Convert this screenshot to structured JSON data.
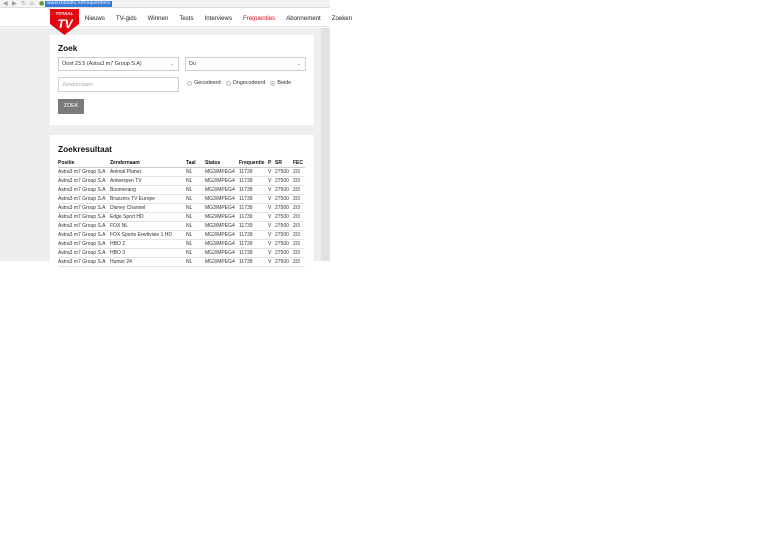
{
  "browser": {
    "url": "www.totaaltv.nl/frequenties/",
    "back_glyph": "◀",
    "forward_glyph": "▶",
    "reload_glyph": "↻",
    "home_glyph": "⌂"
  },
  "site": {
    "logo_text": "TOTAAL",
    "logo_letters": "TV",
    "brand_color": "#e30613"
  },
  "nav": [
    "Nieuws",
    "TV-gids",
    "Winnen",
    "Tests",
    "Interviews",
    "Frequenties",
    "Abonnement",
    "Zoeken"
  ],
  "nav_active": "Frequenties",
  "search": {
    "title": "Zoek",
    "satellite_select": "Oost 23.5 (Astra3 m7 Group S.A)",
    "language_select": "Du",
    "channel_placeholder": "Zendernaam",
    "radio_options": [
      "Gecodeerd",
      "Ongecodeerd",
      "Beide"
    ],
    "radio_selected": "Beide",
    "button_label": "ZOEK"
  },
  "results": {
    "title": "Zoekresultaat",
    "columns": [
      "Positie",
      "Zendernaam",
      "Taal",
      "Status",
      "Frequentie",
      "P",
      "SR",
      "FEC"
    ],
    "rows": [
      [
        "Astra3 m7 Group S.A",
        "Animal Planet",
        "NL",
        "MG3/MPEG4",
        "11739",
        "V",
        "27500",
        "2/3"
      ],
      [
        "Astra3 m7 Group S.A",
        "Antwerpen TV",
        "NL",
        "MG3/MPEG4",
        "11739",
        "V",
        "27500",
        "2/3"
      ],
      [
        "Astra3 m7 Group S.A",
        "Boomerang",
        "NL",
        "MG3/MPEG4",
        "11739",
        "V",
        "27500",
        "2/3"
      ],
      [
        "Astra3 m7 Group S.A",
        "Brazzers TV Europe",
        "NL",
        "MG3/MPEG4",
        "11739",
        "V",
        "27500",
        "2/3"
      ],
      [
        "Astra3 m7 Group S.A",
        "Disney Channel",
        "NL",
        "MG3/MPEG4",
        "11739",
        "V",
        "27500",
        "2/3"
      ],
      [
        "Astra3 m7 Group S.A",
        "Edge Sport HD",
        "NL",
        "MG3/MPEG4",
        "11739",
        "V",
        "27500",
        "2/3"
      ],
      [
        "Astra3 m7 Group S.A",
        "FOX NL",
        "NL",
        "MG3/MPEG4",
        "11739",
        "V",
        "27500",
        "2/3"
      ],
      [
        "Astra3 m7 Group S.A",
        "FOX Sports Eredivisie 1 HD",
        "NL",
        "MG3/MPEG4",
        "11739",
        "V",
        "27500",
        "2/3"
      ],
      [
        "Astra3 m7 Group S.A",
        "HBO 2",
        "NL",
        "MG3/MPEG4",
        "11739",
        "V",
        "27500",
        "2/3"
      ],
      [
        "Astra3 m7 Group S.A",
        "HBO 3",
        "NL",
        "MG3/MPEG4",
        "11739",
        "V",
        "27500",
        "2/3"
      ],
      [
        "Astra3 m7 Group S.A",
        "Humor 24",
        "NL",
        "MG3/MPEG4",
        "11739",
        "V",
        "27500",
        "2/3"
      ]
    ]
  }
}
